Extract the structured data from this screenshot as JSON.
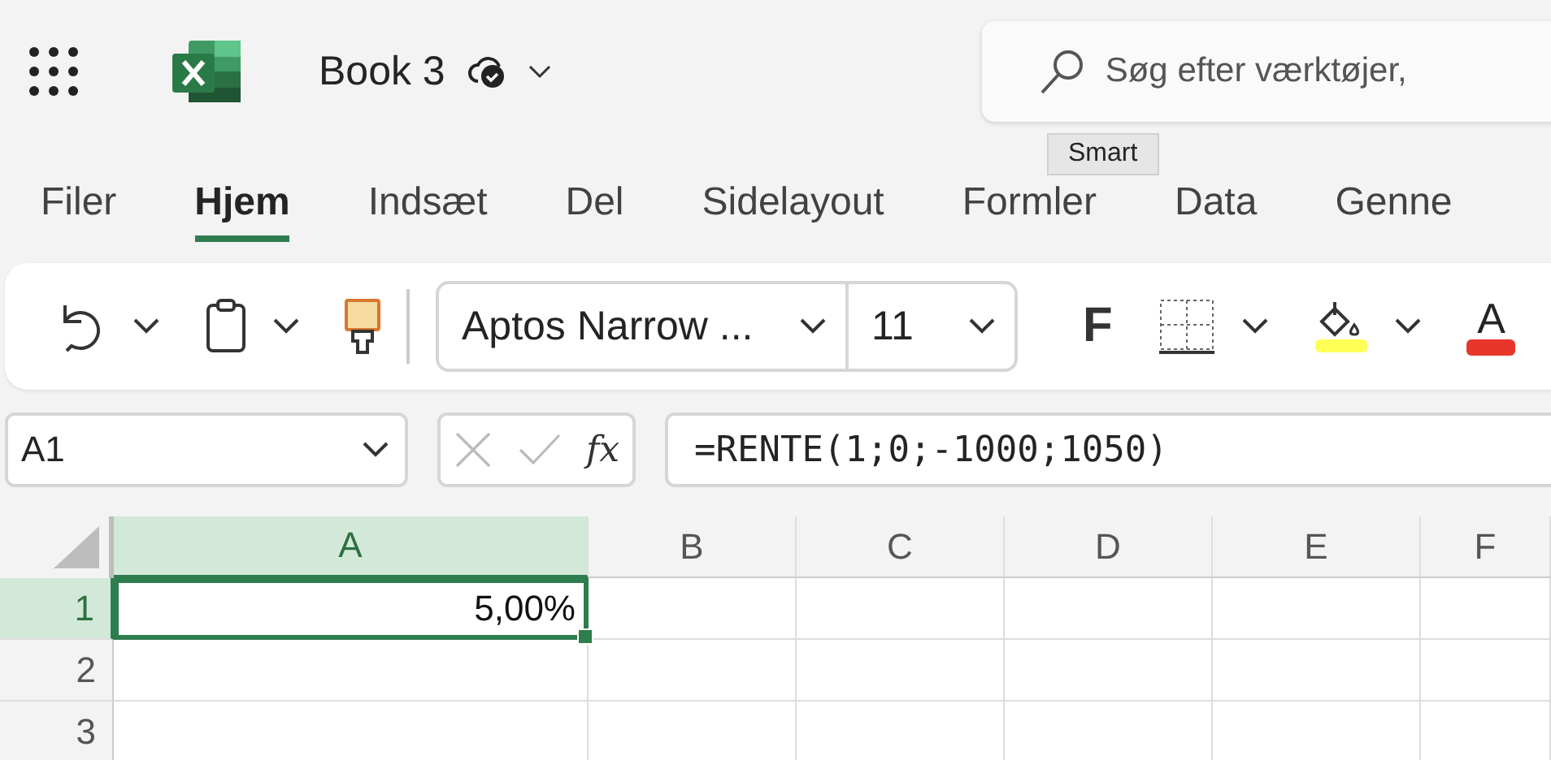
{
  "header": {
    "title": "Book 3",
    "search": {
      "placeholder": "Søg efter værktøjer,"
    },
    "tooltip": "Smart"
  },
  "tabs": [
    {
      "label": "Filer",
      "selected": false
    },
    {
      "label": "Hjem",
      "selected": true
    },
    {
      "label": "Indsæt",
      "selected": false
    },
    {
      "label": "Del",
      "selected": false
    },
    {
      "label": "Sidelayout",
      "selected": false
    },
    {
      "label": "Formler",
      "selected": false
    },
    {
      "label": "Data",
      "selected": false
    },
    {
      "label": "Genne",
      "selected": false
    }
  ],
  "toolbar": {
    "font": "Aptos Narrow ...",
    "size": "11",
    "bold_label": "F",
    "font_color_label": "A"
  },
  "formula_bar": {
    "name_box": "A1",
    "fx": "fx",
    "formula": "=RENTE(1;0;-1000;1050)"
  },
  "sheet": {
    "columns": [
      {
        "label": "A",
        "selected": true
      },
      {
        "label": "B",
        "selected": false
      },
      {
        "label": "C",
        "selected": false
      },
      {
        "label": "D",
        "selected": false
      },
      {
        "label": "E",
        "selected": false
      },
      {
        "label": "F",
        "selected": false
      }
    ],
    "rows": [
      {
        "label": "1",
        "selected": true,
        "cells": [
          "5,00%",
          "",
          "",
          "",
          "",
          ""
        ]
      },
      {
        "label": "2",
        "selected": false,
        "cells": [
          "",
          "",
          "",
          "",
          "",
          ""
        ]
      },
      {
        "label": "3",
        "selected": false,
        "cells": [
          "",
          "",
          "",
          "",
          "",
          ""
        ]
      }
    ]
  }
}
